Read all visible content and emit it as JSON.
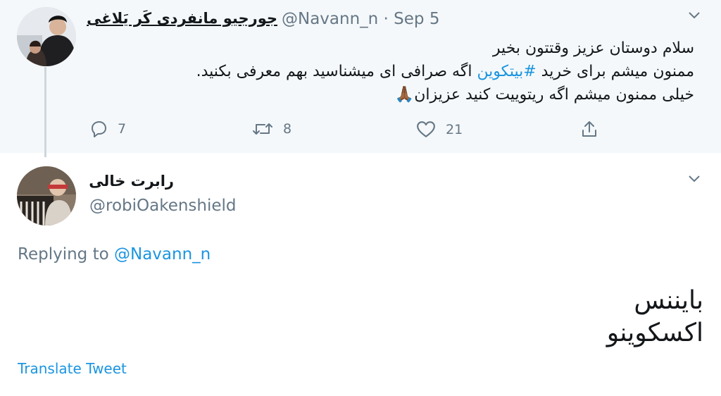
{
  "parent_tweet": {
    "display_name": "جورجیو مانفردی کَر یَلاغی",
    "handle_date": "@Navann_n · Sep 5",
    "lines": [
      {
        "text": "سلام دوستان عزیز وقتتون بخیر"
      },
      {
        "before": "ممنون میشم برای خرید ",
        "hashtag": "#بیتکوین",
        "after": " اگه صرافی ای میشناسید بهم معرفی بکنید."
      },
      {
        "text": "خیلی ممنون میشم اگه ریتوییت کنید عزیزان🙏🏾"
      }
    ],
    "replies": "7",
    "retweets": "8",
    "likes": "21"
  },
  "reply_tweet": {
    "display_name": "رابرت خالی",
    "handle": "@robiOakenshield",
    "replying_label": "Replying to",
    "replying_to": "@Navann_n",
    "lines": [
      "بایننس",
      "اکسکوینو"
    ],
    "translate_label": "Translate Tweet"
  },
  "colors": {
    "accent": "#1b95e0",
    "muted": "#657786",
    "parent_bg": "#f5f8fa"
  },
  "icons": [
    "reply-icon",
    "retweet-icon",
    "like-icon",
    "share-icon",
    "chevron-down-icon"
  ]
}
